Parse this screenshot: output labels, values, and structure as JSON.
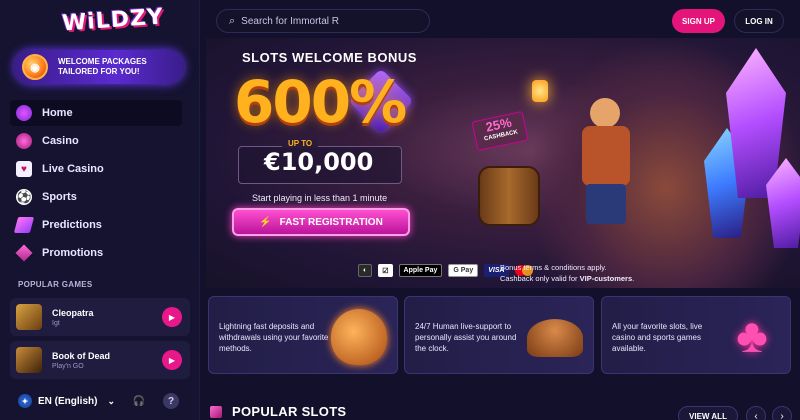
{
  "brand": {
    "logo_text": "WiLDZY"
  },
  "promo": {
    "text": "WELCOME PACKAGES\nTAILORED FOR YOU!"
  },
  "nav": {
    "items": [
      {
        "label": "Home",
        "icon": "home-icon"
      },
      {
        "label": "Casino",
        "icon": "casino-chip-icon"
      },
      {
        "label": "Live Casino",
        "icon": "playing-cards-icon"
      },
      {
        "label": "Sports",
        "icon": "soccer-ball-icon"
      },
      {
        "label": "Predictions",
        "icon": "predictions-icon"
      },
      {
        "label": "Promotions",
        "icon": "diamond-icon"
      }
    ]
  },
  "popular_games": {
    "title": "POPULAR GAMES",
    "items": [
      {
        "name": "Cleopatra",
        "provider": "Igt"
      },
      {
        "name": "Book of Dead",
        "provider": "Play'n GO"
      }
    ]
  },
  "footer": {
    "language": "EN (English)"
  },
  "header": {
    "search_placeholder": "Search for Immortal R",
    "signup_label": "SIGN UP",
    "login_label": "LOG IN"
  },
  "banner": {
    "title": "SLOTS WELCOME BONUS",
    "percent": "600%",
    "upto": "UP TO",
    "amount": "€10,000",
    "subline": "Start playing in less than 1 minute",
    "cta": "FAST REGISTRATION",
    "cashback_pct": "25%",
    "cashback_label": "CASHBACK",
    "payments": [
      "Apple Pay",
      "G Pay",
      "VISA"
    ],
    "terms_line1": "Bonus terms & conditions apply.",
    "terms_line2_prefix": "Cashback only valid for ",
    "terms_line2_bold": "VIP-customers",
    "terms_line2_suffix": "."
  },
  "features": [
    {
      "text": "Lightning fast deposits and withdrawals using your favorite methods.",
      "icon": "money-bag-icon"
    },
    {
      "text": "24/7 Human live-support to personally assist you around the clock.",
      "icon": "cowboy-hat-icon"
    },
    {
      "text": "All your favorite slots, live casino and sports games available.",
      "icon": "club-suit-icon"
    }
  ],
  "popular_slots": {
    "title": "POPULAR SLOTS",
    "view_all": "VIEW ALL"
  },
  "colors": {
    "accent": "#e5147a",
    "background": "#12102a",
    "sidebar": "#151330",
    "gold": "#ffb21e"
  }
}
